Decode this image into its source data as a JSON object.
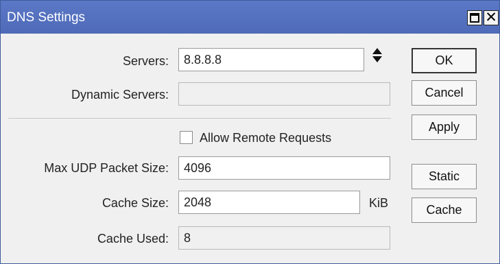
{
  "window": {
    "title": "DNS Settings",
    "maximize_icon": "maximize-icon",
    "close_glyph": "✕"
  },
  "form": {
    "servers_label": "Servers:",
    "servers_value": "8.8.8.8",
    "dynamic_servers_label": "Dynamic Servers:",
    "dynamic_servers_value": "",
    "allow_remote_label": "Allow Remote Requests",
    "allow_remote_checked": false,
    "max_udp_label": "Max UDP Packet Size:",
    "max_udp_value": "4096",
    "cache_size_label": "Cache Size:",
    "cache_size_value": "2048",
    "cache_size_unit": "KiB",
    "cache_used_label": "Cache Used:",
    "cache_used_value": "8"
  },
  "buttons": {
    "ok": "OK",
    "cancel": "Cancel",
    "apply": "Apply",
    "static": "Static",
    "cache": "Cache"
  },
  "colors": {
    "titlebar": "#5570bf",
    "window_bg": "#f0f0f0"
  }
}
